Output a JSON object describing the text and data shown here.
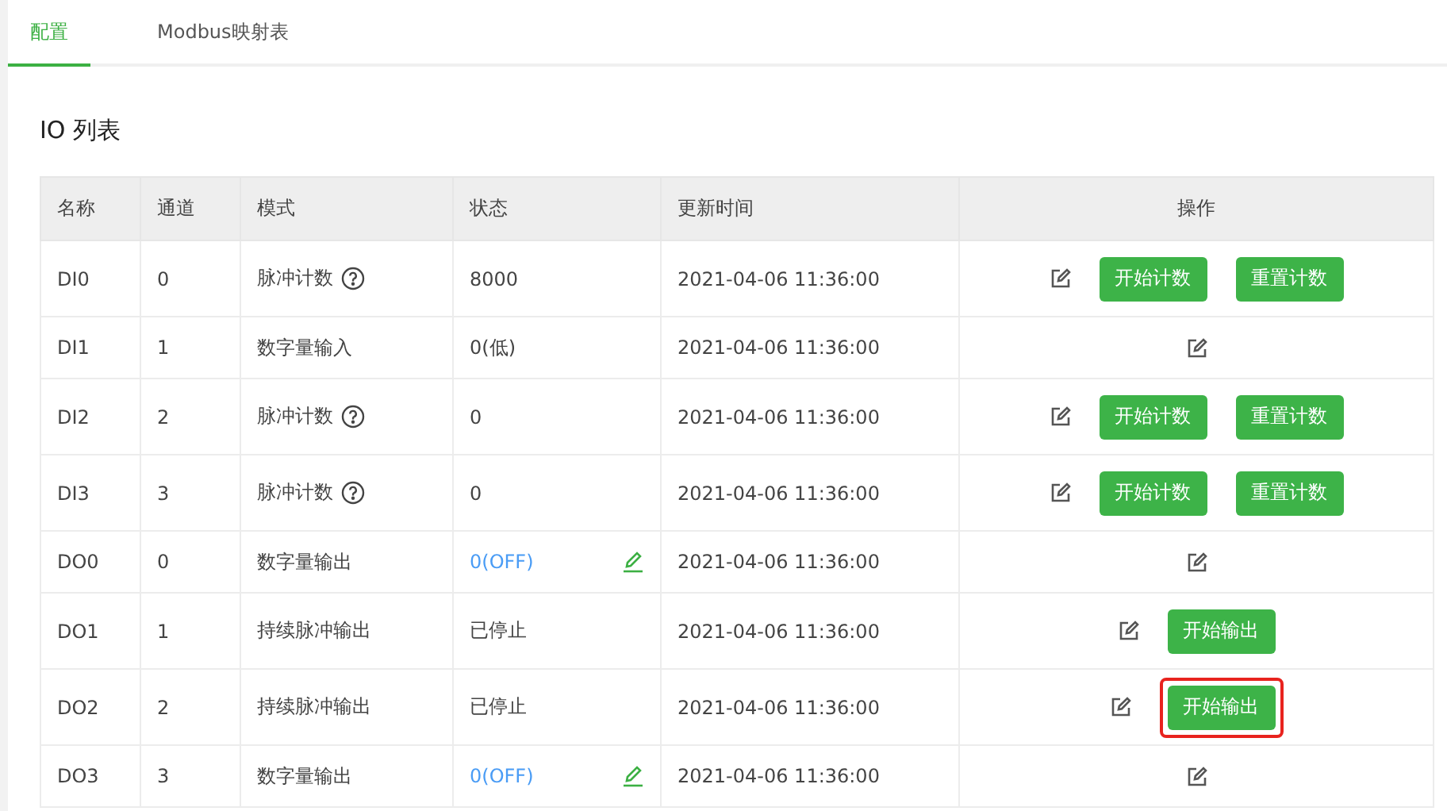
{
  "tabs": [
    {
      "label": "配置",
      "selected": true
    },
    {
      "label": "Modbus映射表",
      "selected": false
    }
  ],
  "section_title": "IO 列表",
  "table": {
    "columns": [
      "名称",
      "通道",
      "模式",
      "状态",
      "更新时间",
      "操作"
    ],
    "rows": [
      {
        "name": "DI0",
        "channel": "0",
        "mode": "脉冲计数",
        "mode_help": true,
        "status": {
          "kind": "text",
          "text": "8000"
        },
        "updated": "2021-04-06 11:36:00",
        "actions": [
          {
            "label": "开始计数",
            "highlighted": false
          },
          {
            "label": "重置计数",
            "highlighted": false
          }
        ]
      },
      {
        "name": "DI1",
        "channel": "1",
        "mode": "数字量输入",
        "mode_help": false,
        "status": {
          "kind": "text",
          "text": "0(低)"
        },
        "updated": "2021-04-06 11:36:00",
        "actions": []
      },
      {
        "name": "DI2",
        "channel": "2",
        "mode": "脉冲计数",
        "mode_help": true,
        "status": {
          "kind": "text",
          "text": "0"
        },
        "updated": "2021-04-06 11:36:00",
        "actions": [
          {
            "label": "开始计数",
            "highlighted": false
          },
          {
            "label": "重置计数",
            "highlighted": false
          }
        ]
      },
      {
        "name": "DI3",
        "channel": "3",
        "mode": "脉冲计数",
        "mode_help": true,
        "status": {
          "kind": "text",
          "text": "0"
        },
        "updated": "2021-04-06 11:36:00",
        "actions": [
          {
            "label": "开始计数",
            "highlighted": false
          },
          {
            "label": "重置计数",
            "highlighted": false
          }
        ]
      },
      {
        "name": "DO0",
        "channel": "0",
        "mode": "数字量输出",
        "mode_help": false,
        "status": {
          "kind": "editable",
          "text": "0(OFF)"
        },
        "updated": "2021-04-06 11:36:00",
        "actions": []
      },
      {
        "name": "DO1",
        "channel": "1",
        "mode": "持续脉冲输出",
        "mode_help": false,
        "status": {
          "kind": "text",
          "text": "已停止"
        },
        "updated": "2021-04-06 11:36:00",
        "actions": [
          {
            "label": "开始输出",
            "highlighted": false
          }
        ]
      },
      {
        "name": "DO2",
        "channel": "2",
        "mode": "持续脉冲输出",
        "mode_help": false,
        "status": {
          "kind": "text",
          "text": "已停止"
        },
        "updated": "2021-04-06 11:36:00",
        "actions": [
          {
            "label": "开始输出",
            "highlighted": true
          }
        ]
      },
      {
        "name": "DO3",
        "channel": "3",
        "mode": "数字量输出",
        "mode_help": false,
        "status": {
          "kind": "editable",
          "text": "0(OFF)"
        },
        "updated": "2021-04-06 11:36:00",
        "actions": []
      }
    ]
  }
}
